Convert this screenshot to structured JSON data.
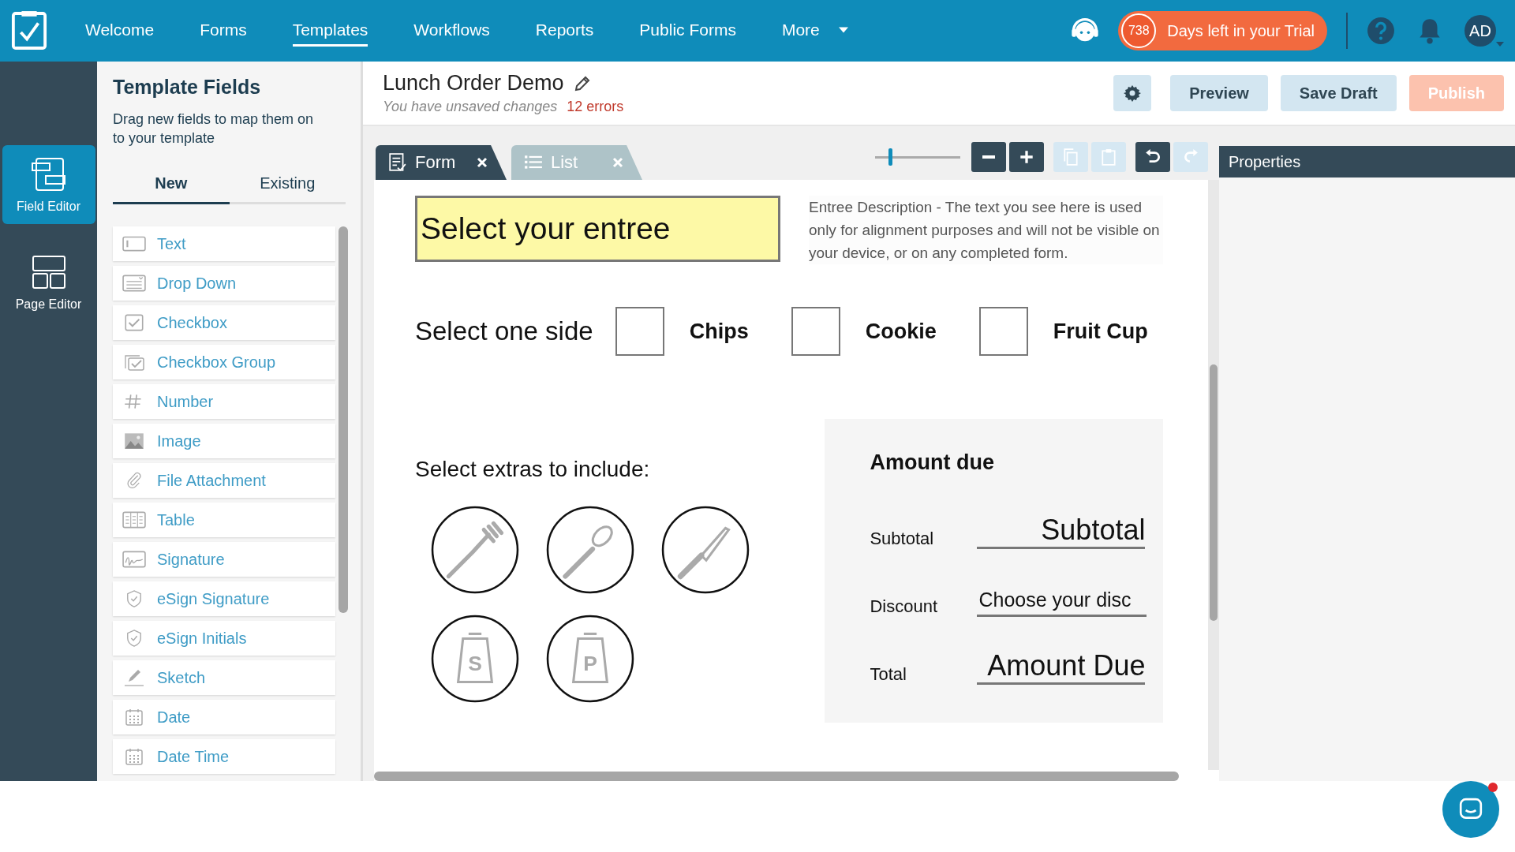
{
  "nav": {
    "items": [
      {
        "label": "Welcome",
        "selected": false
      },
      {
        "label": "Forms",
        "selected": false
      },
      {
        "label": "Templates",
        "selected": true
      },
      {
        "label": "Workflows",
        "selected": false
      },
      {
        "label": "Reports",
        "selected": false
      },
      {
        "label": "Public Forms",
        "selected": false
      }
    ],
    "more": "More",
    "trial": {
      "count": "738",
      "label": "Days left in your Trial"
    },
    "avatar": "AD"
  },
  "rail": [
    {
      "label": "Field Editor",
      "kind": "field",
      "selected": true
    },
    {
      "label": "Page Editor",
      "kind": "page",
      "selected": false
    }
  ],
  "fields_panel": {
    "title": "Template Fields",
    "subtitle": "Drag new fields to map them on to your template",
    "tabs": [
      {
        "label": "New",
        "selected": true
      },
      {
        "label": "Existing",
        "selected": false
      }
    ],
    "items": [
      {
        "label": "Text",
        "kind": "text"
      },
      {
        "label": "Drop Down",
        "kind": "dropdown"
      },
      {
        "label": "Checkbox",
        "kind": "checkbox"
      },
      {
        "label": "Checkbox Group",
        "kind": "checkgroup"
      },
      {
        "label": "Number",
        "kind": "number"
      },
      {
        "label": "Image",
        "kind": "image"
      },
      {
        "label": "File Attachment",
        "kind": "attachment"
      },
      {
        "label": "Table",
        "kind": "table"
      },
      {
        "label": "Signature",
        "kind": "signature"
      },
      {
        "label": "eSign Signature",
        "kind": "shield"
      },
      {
        "label": "eSign Initials",
        "kind": "shield"
      },
      {
        "label": "Sketch",
        "kind": "sketch"
      },
      {
        "label": "Date",
        "kind": "date"
      },
      {
        "label": "Date Time",
        "kind": "date"
      }
    ]
  },
  "header": {
    "title": "Lunch Order Demo",
    "status": "You have unsaved changes",
    "errors": "12 errors",
    "buttons": [
      {
        "kind": "settings",
        "disabled": false
      },
      {
        "kind": "secondary",
        "label": "Preview",
        "disabled": false
      },
      {
        "kind": "secondary",
        "label": "Save Draft",
        "disabled": false
      },
      {
        "kind": "primary",
        "label": "Publish",
        "disabled": true
      }
    ]
  },
  "doc_tabs": [
    {
      "label": "Form",
      "kind": "form",
      "selected": true
    },
    {
      "label": "List",
      "kind": "list",
      "selected": false
    }
  ],
  "toolbar": {
    "zoom": {
      "level": 0.18
    },
    "buttons": [
      {
        "kind": "minus",
        "disabled": false
      },
      {
        "kind": "plus",
        "disabled": false
      },
      {
        "kind": "copy",
        "disabled": true
      },
      {
        "kind": "paste",
        "disabled": true
      },
      {
        "kind": "undo",
        "disabled": false
      },
      {
        "kind": "redo",
        "disabled": true
      }
    ]
  },
  "properties": {
    "title": "Properties"
  },
  "form": {
    "entree": "Select your entree",
    "description": "Entree Description - The text you see here is used only for alignment purposes and will not be visible on your device, or on any completed form.",
    "side_label": "Select one side",
    "sides": [
      {
        "label": "Chips",
        "checked": false
      },
      {
        "label": "Cookie",
        "checked": false
      },
      {
        "label": "Fruit Cup",
        "checked": false
      }
    ],
    "extras_label": "Select extras to include:",
    "extras": [
      {
        "kind": "fork"
      },
      {
        "kind": "spoon"
      },
      {
        "kind": "knife"
      },
      {
        "kind": "shaker",
        "letter": "S"
      },
      {
        "kind": "shaker",
        "letter": "P"
      }
    ],
    "amount": {
      "title": "Amount due",
      "rows": [
        {
          "label": "Subtotal",
          "value": "Subtotal",
          "kind": "amount"
        },
        {
          "label": "Discount",
          "value": "Choose your disc",
          "kind": "choice"
        },
        {
          "label": "Total",
          "value": "Amount Due",
          "kind": "amount"
        }
      ]
    }
  },
  "chat": {
    "unread": true
  }
}
